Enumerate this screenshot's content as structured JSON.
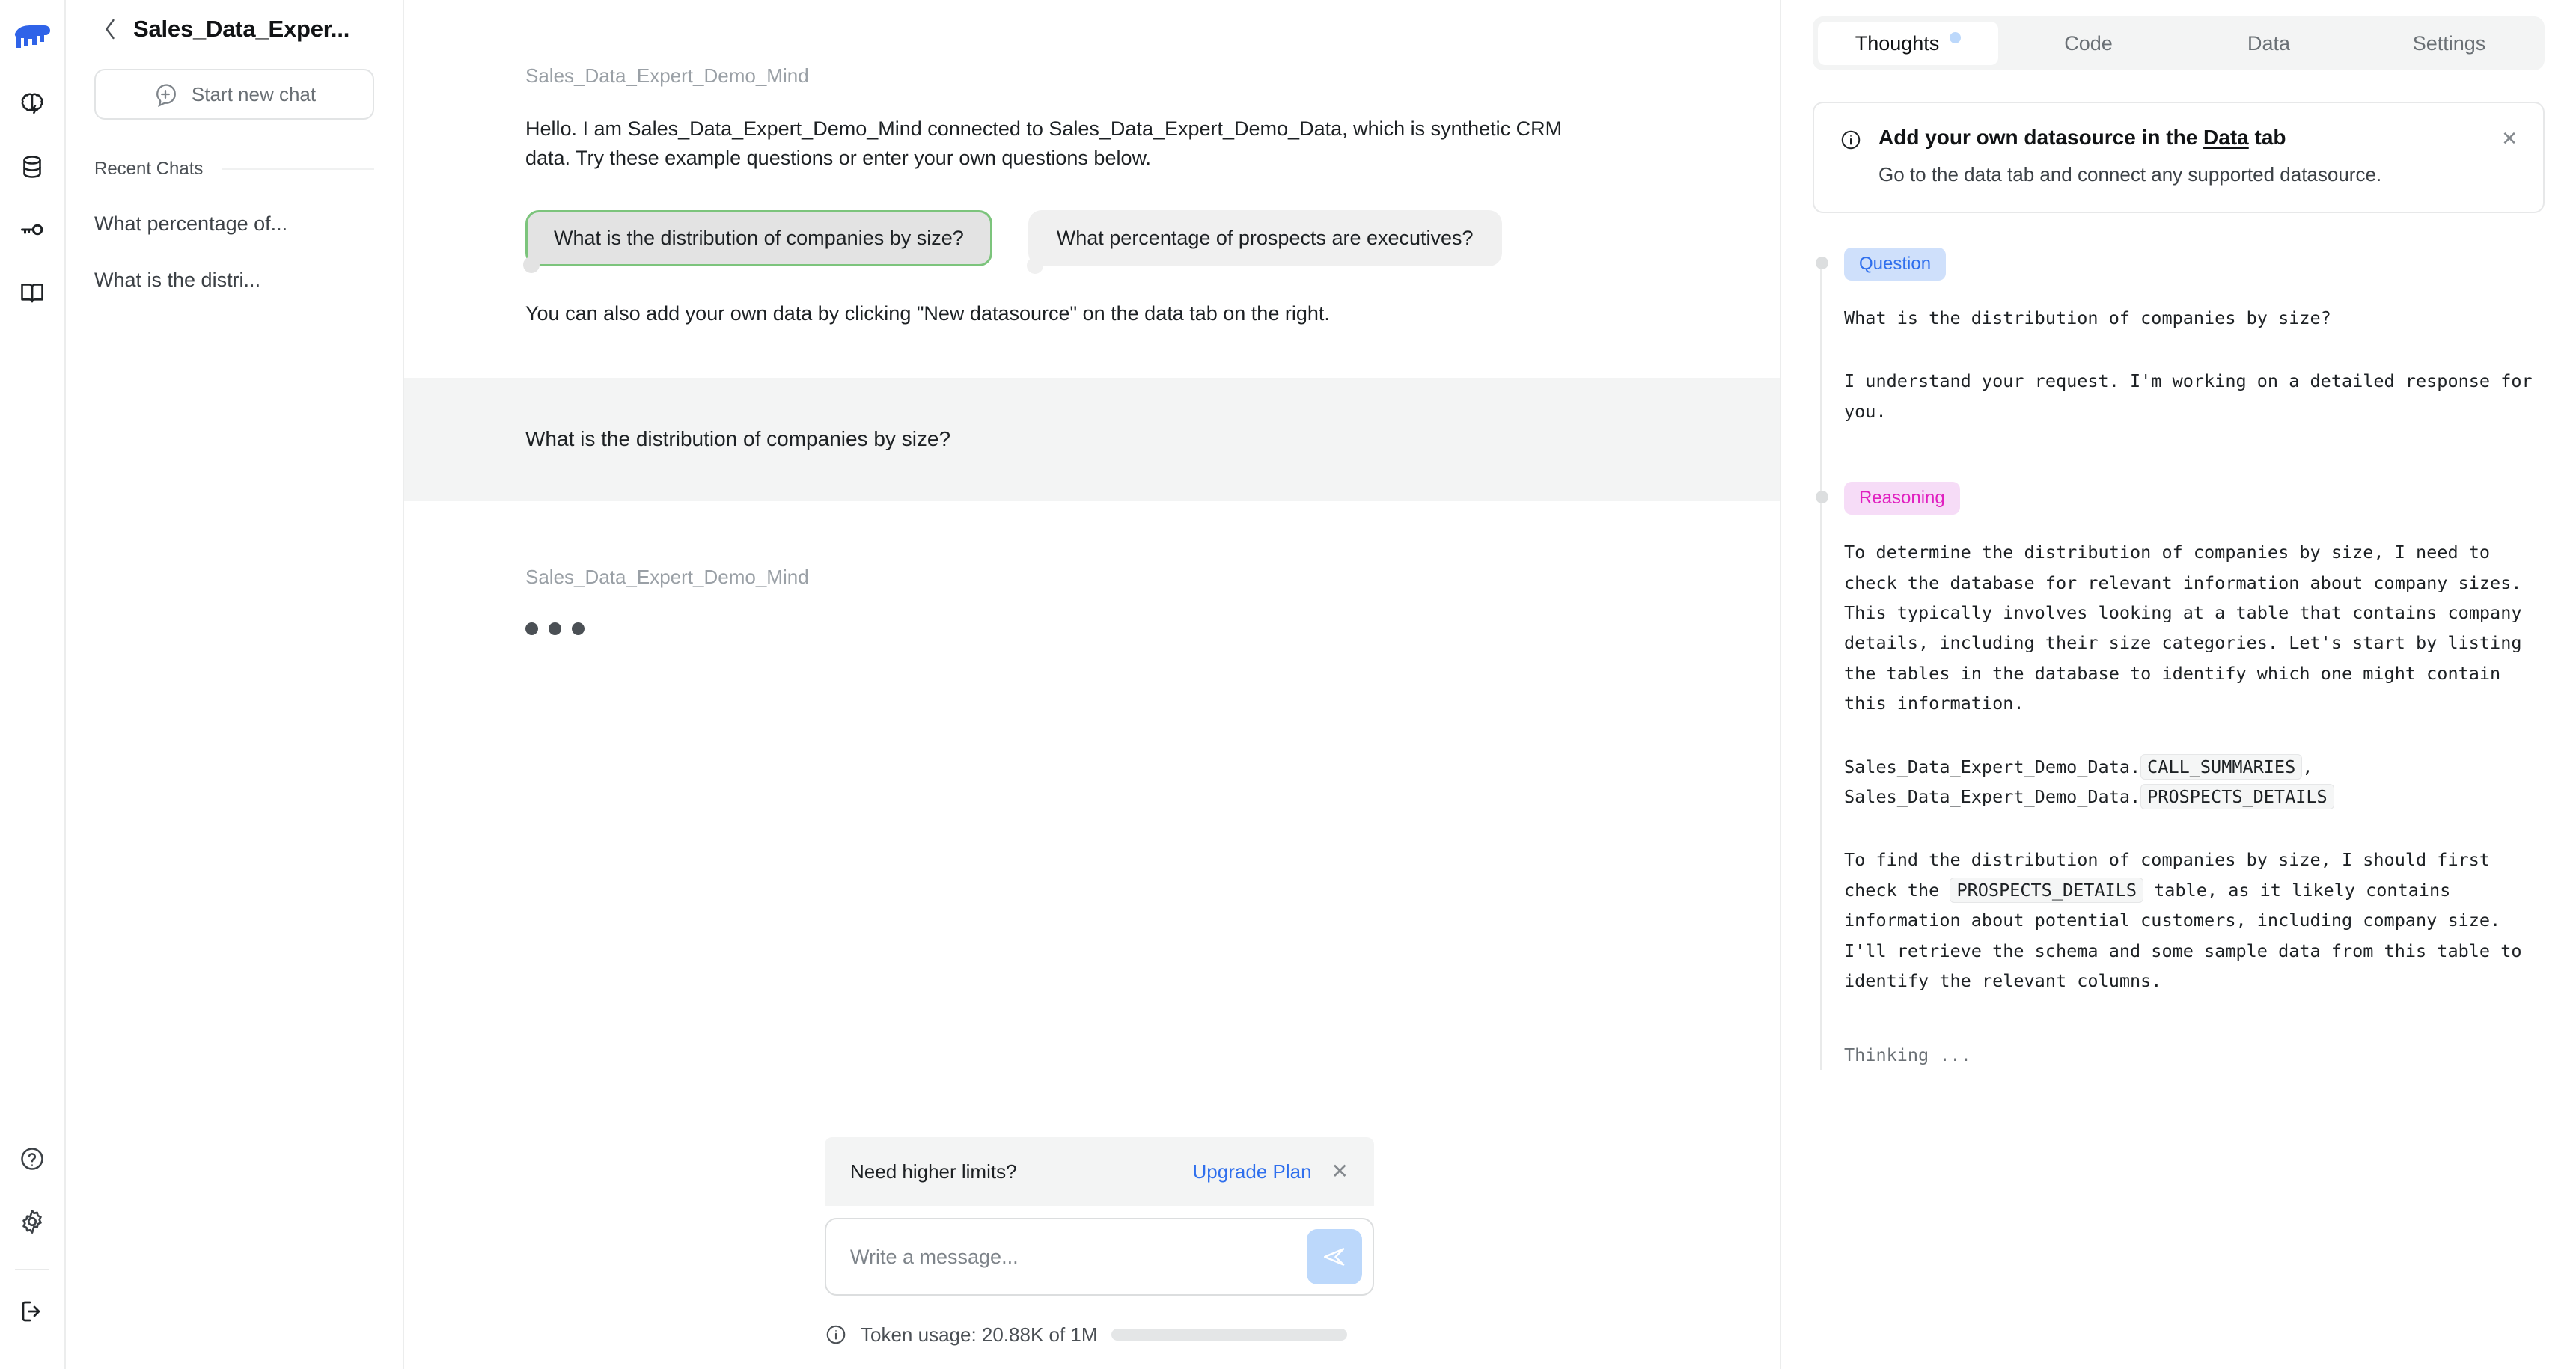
{
  "rail": {
    "logo": "mindsdb-elephant-logo",
    "items": [
      {
        "name": "brain-icon",
        "title": "Minds"
      },
      {
        "name": "database-icon",
        "title": "Datasources"
      },
      {
        "name": "key-icon",
        "title": "API Keys"
      },
      {
        "name": "book-icon",
        "title": "Docs"
      }
    ],
    "bottom": [
      {
        "name": "help-icon",
        "title": "Help"
      },
      {
        "name": "gear-icon",
        "title": "Settings"
      },
      {
        "name": "logout-icon",
        "title": "Log out"
      }
    ]
  },
  "sidebar": {
    "title": "Sales_Data_Exper...",
    "back_icon": "chevron-left-icon",
    "new_chat_label": "Start new chat",
    "new_chat_icon": "chat-plus-icon",
    "recent_label": "Recent Chats",
    "recent_chats": [
      "What percentage of...",
      "What is the distri..."
    ]
  },
  "chat": {
    "assistant_name": "Sales_Data_Expert_Demo_Mind",
    "greeting": "Hello. I am Sales_Data_Expert_Demo_Mind connected to Sales_Data_Expert_Demo_Data, which is synthetic CRM data. Try these example questions or enter your own questions below.",
    "suggestions": [
      {
        "label": "What is the distribution of companies by size?",
        "selected": true
      },
      {
        "label": "What percentage of prospects are executives?",
        "selected": false
      }
    ],
    "footnote": "You can also add your own data by clicking \"New datasource\" on the data tab on the right.",
    "user_message": "What is the distribution of companies by size?",
    "pending_assistant_name": "Sales_Data_Expert_Demo_Mind",
    "typing_indicator": "loading-dots"
  },
  "composer": {
    "limits_text": "Need higher limits?",
    "upgrade_label": "Upgrade Plan",
    "close_icon": "close-icon",
    "input_placeholder": "Write a message...",
    "input_value": "",
    "send_icon": "send-icon",
    "token_info_icon": "info-icon",
    "token_usage_text": "Token usage: 20.88K of 1M",
    "token_used": "20.88K",
    "token_limit": "1M",
    "token_percent": 2.1
  },
  "right_panel": {
    "tabs": [
      {
        "label": "Thoughts",
        "active": true,
        "badge": true
      },
      {
        "label": "Code",
        "active": false,
        "badge": false
      },
      {
        "label": "Data",
        "active": false,
        "badge": false
      },
      {
        "label": "Settings",
        "active": false,
        "badge": false
      }
    ],
    "notice": {
      "icon": "info-icon",
      "title_before": "Add your own datasource in the ",
      "title_link": "Data",
      "title_after": " tab",
      "subtitle": "Go to the data tab and connect any supported datasource.",
      "close_icon": "close-icon"
    },
    "timeline": [
      {
        "badge": "Question",
        "badge_type": "question",
        "paragraphs": [
          "What is the distribution of companies by size?",
          "I understand your request. I'm working on a detailed response for you."
        ]
      },
      {
        "badge": "Reasoning",
        "badge_type": "reasoning",
        "paragraphs": [
          "To determine the distribution of companies by size, I need to check the database for relevant information about company sizes. This typically involves looking at a table that contains company details, including their size categories. Let's start by listing the tables in the database to identify which one might contain this information."
        ],
        "table_line_1_prefix": "Sales_Data_Expert_Demo_Data.",
        "table_line_1_code": "CALL_SUMMARIES",
        "table_line_1_suffix": ",",
        "table_line_2_prefix": "Sales_Data_Expert_Demo_Data.",
        "table_line_2_code": "PROSPECTS_DETAILS",
        "closing_1": "To find the distribution of companies by size, I should first check the ",
        "closing_code": "PROSPECTS_DETAILS",
        "closing_2": " table, as it likely contains information about potential customers, including company size. I'll retrieve the schema and some sample data from this table to identify the relevant columns."
      }
    ],
    "status": "Thinking ..."
  },
  "colors": {
    "brand_blue": "#2f6fed",
    "logo_blue": "#2f63e8",
    "accent_light_blue": "#bcd8fb",
    "selected_green": "#7cc47c",
    "badge_question_bg": "#cfe0fb",
    "badge_question_fg": "#2f6fed",
    "badge_reasoning_bg": "#f6dcf7",
    "badge_reasoning_fg": "#e020c0",
    "user_bubble_bg": "#f3f4f4"
  }
}
